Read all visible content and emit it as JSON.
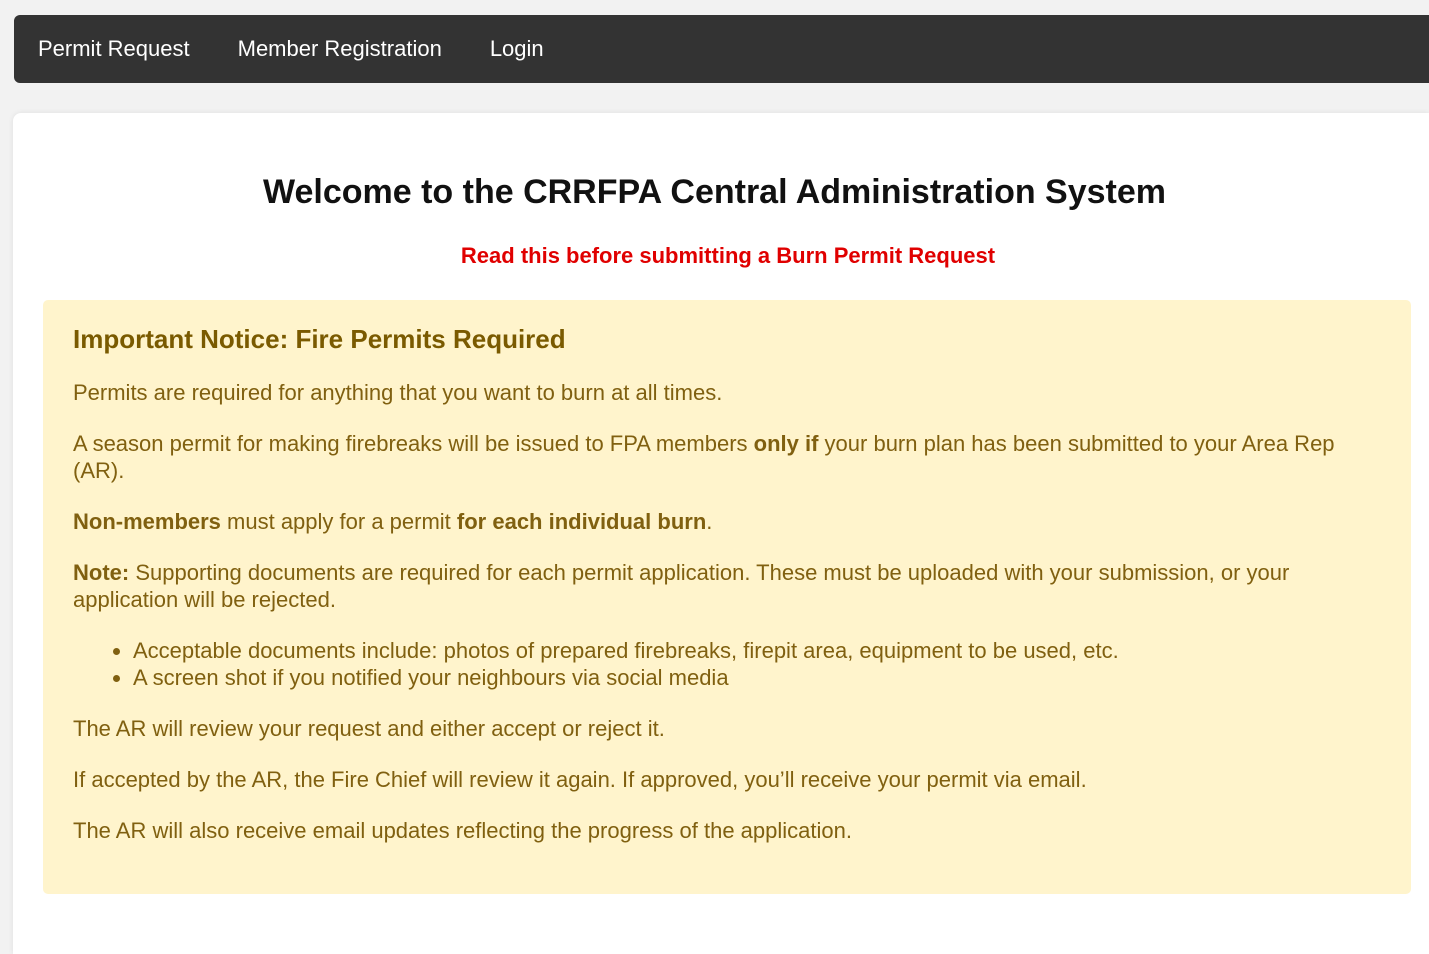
{
  "nav": {
    "items": [
      {
        "label": "Permit Request"
      },
      {
        "label": "Member Registration"
      },
      {
        "label": "Login"
      }
    ]
  },
  "main": {
    "title": "Welcome to the CRRFPA Central Administration System",
    "warning_link": "Read this before submitting a Burn Permit Request"
  },
  "notice": {
    "heading": "Important Notice: Fire Permits Required",
    "p1": "Permits are required for anything that you want to burn at all times.",
    "p2": {
      "before": "A season permit for making firebreaks will be issued to FPA members ",
      "bold": "only if",
      "after": " your burn plan has been submitted to your Area Rep (AR)."
    },
    "p3": {
      "bold1": "Non-members",
      "mid": " must apply for a permit ",
      "bold2": "for each individual burn",
      "end": "."
    },
    "p4": {
      "bold": "Note:",
      "text": " Supporting documents are required for each permit application. These must be uploaded with your submission, or your application will be rejected."
    },
    "list": [
      "Acceptable documents include: photos of prepared firebreaks, firepit area, equipment to be used, etc.",
      "A screen shot if you notified your neighbours via social media"
    ],
    "p5": "The AR will review your request and either accept or reject it.",
    "p6": "If accepted by the AR, the Fire Chief will review it again. If approved, you’ll receive your permit via email.",
    "p7": "The AR will also receive email updates reflecting the progress of the application."
  },
  "colors": {
    "navbar": "#333333",
    "warning": "#e00000",
    "notice_bg": "#fff4cc",
    "notice_text": "#806010"
  }
}
